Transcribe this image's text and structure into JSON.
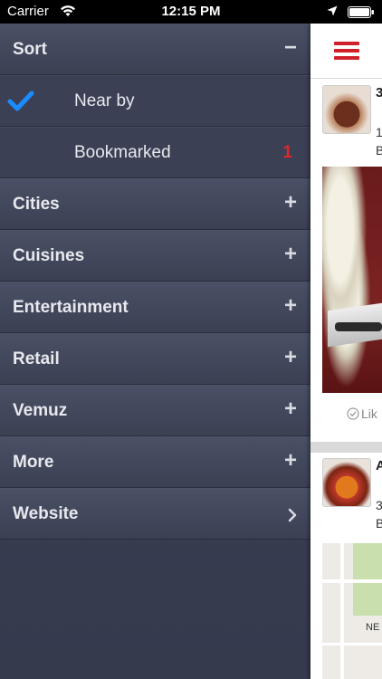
{
  "status_bar": {
    "carrier": "Carrier",
    "time": "12:15 PM"
  },
  "menu": {
    "sections": [
      {
        "label": "Sort",
        "sign": "−",
        "expanded": true
      },
      {
        "label": "Cities",
        "sign": "+"
      },
      {
        "label": "Cuisines",
        "sign": "+"
      },
      {
        "label": "Entertainment",
        "sign": "+"
      },
      {
        "label": "Retail",
        "sign": "+"
      },
      {
        "label": "Vemuz",
        "sign": "+"
      },
      {
        "label": "More",
        "sign": "+"
      },
      {
        "label": "Website",
        "icon": "chevron-right-icon"
      }
    ],
    "sort_options": [
      {
        "label": "Near by",
        "selected": true,
        "icon": "checkmark-icon"
      },
      {
        "label": "Bookmarked",
        "badge": "1"
      }
    ]
  },
  "content": {
    "card1": {
      "number": "3",
      "line1": "1",
      "line2": "B",
      "like_label": "Lik"
    },
    "card2": {
      "initial": "A",
      "line1": "3",
      "line2": "B",
      "map_label": "NE"
    }
  },
  "colors": {
    "menu_bg": "#3a3f52",
    "accent_red": "#d0202a",
    "check_blue": "#1a8cff",
    "badge_red": "#e3262b"
  }
}
